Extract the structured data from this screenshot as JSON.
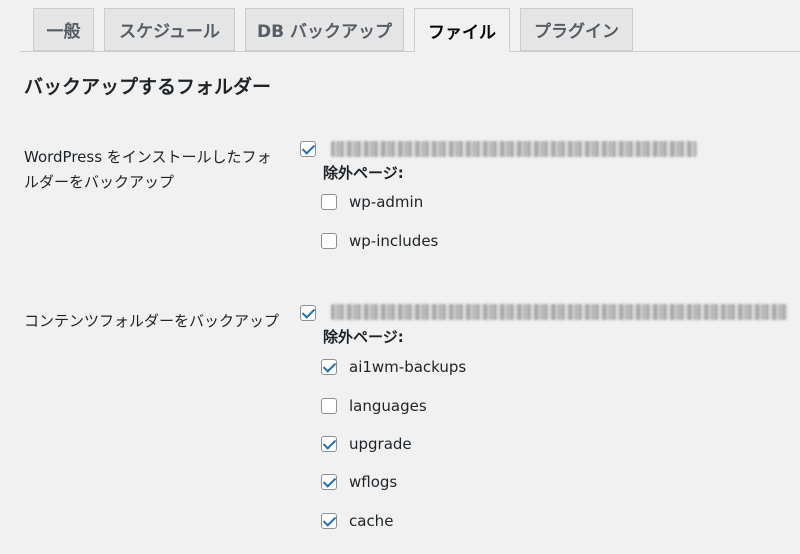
{
  "tabs": [
    {
      "label": "一般",
      "active": false
    },
    {
      "label": "スケジュール",
      "active": false
    },
    {
      "label": "DB バックアップ",
      "active": false
    },
    {
      "label": "ファイル",
      "active": true
    },
    {
      "label": "プラグイン",
      "active": false
    }
  ],
  "section": {
    "title": "バックアップするフォルダー"
  },
  "wordpress_folder": {
    "label": "WordPress をインストールしたフォルダーをバックアップ",
    "checked": true,
    "exclude_label": "除外ページ:",
    "excludes": [
      {
        "name": "wp-admin",
        "checked": false
      },
      {
        "name": "wp-includes",
        "checked": false
      }
    ]
  },
  "content_folder": {
    "label": "コンテンツフォルダーをバックアップ",
    "checked": true,
    "exclude_label": "除外ページ:",
    "excludes": [
      {
        "name": "ai1wm-backups",
        "checked": true
      },
      {
        "name": "languages",
        "checked": false
      },
      {
        "name": "upgrade",
        "checked": true
      },
      {
        "name": "wflogs",
        "checked": true
      },
      {
        "name": "cache",
        "checked": true
      }
    ]
  },
  "colors": {
    "background": "#f1f1f1",
    "tab_inactive": "#e5e5e5",
    "checkmark": "#2271b1",
    "border": "#cccccc"
  }
}
